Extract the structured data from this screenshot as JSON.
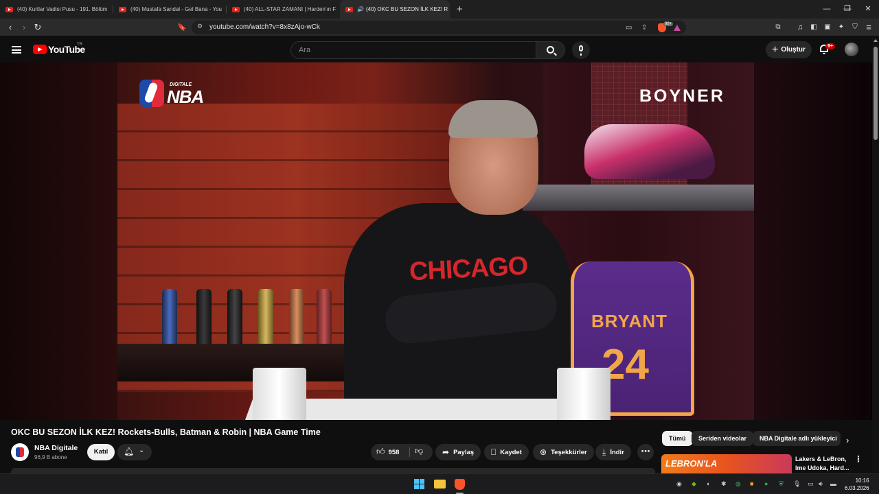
{
  "browser": {
    "tabs": [
      {
        "title": "(40) Kurtlar Vadisi Pusu - 191. Bölüm",
        "active": false
      },
      {
        "title": "(40) Mustafa Sandal - Gel Bana - You",
        "active": false
      },
      {
        "title": "(40) ALL-STAR ZAMANI | Harden'ın F",
        "active": false
      },
      {
        "title": "(40) OKC BU SEZON İLK KEZ! R",
        "active": true,
        "audio_icon": "🔊",
        "close": "✕"
      }
    ],
    "new_tab": "+",
    "window_controls": {
      "minimize": "—",
      "restore": "❐",
      "close": "✕"
    },
    "url": "youtube.com/watch?v=8x8zAjo-wCk",
    "extension_badge": "99+"
  },
  "youtube": {
    "logo_text": "YouTube",
    "country_code": "TR",
    "search": {
      "placeholder": "Ara"
    },
    "create_label": "Oluştur",
    "notification_badge": "9+"
  },
  "video": {
    "overlay_logo_small": "DIGITALE",
    "overlay_logo_big": "NBA",
    "sponsor": "BOYNER",
    "shirt_text": "CHICAGO",
    "jersey_name": "BRYANT",
    "jersey_number": "24",
    "title": "OKC BU SEZON İLK KEZ! Rockets-Bulls, Batman & Robin | NBA Game Time"
  },
  "channel": {
    "name": "NBA Digitale",
    "subscribers": "96,9 B abone",
    "join_label": "Katıl"
  },
  "actions": {
    "like_count": "958",
    "share_label": "Paylaş",
    "save_label": "Kaydet",
    "thanks_label": "Teşekkürler",
    "download_label": "İndir",
    "more": "⋯"
  },
  "sidebar": {
    "chips": [
      {
        "label": "Tümü",
        "selected": true
      },
      {
        "label": "Seriden videolar",
        "selected": false
      },
      {
        "label": "NBA Digitale adlı yükleyici",
        "selected": false
      }
    ],
    "next_chip": "›",
    "recommendation": {
      "thumb_text": "LEBRON'LA",
      "title": "Lakers & LeBron, Ime Udoka, Hard..."
    }
  },
  "taskbar": {
    "time": "10:16",
    "date": "6.03.2026"
  },
  "colors": {
    "yt_red": "#ff0000",
    "background": "#0f0f0f",
    "chip_bg": "#272727",
    "brave_orange": "#fb542b"
  }
}
